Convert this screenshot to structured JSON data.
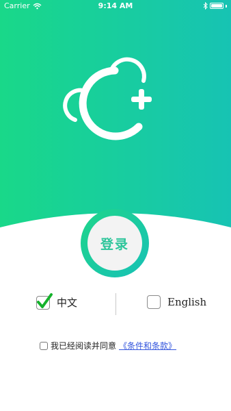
{
  "status_bar": {
    "carrier": "Carrier",
    "time": "9:14 AM",
    "battery_level": 1.0
  },
  "colors": {
    "gradient_start": "#19d889",
    "gradient_end": "#17c3b3",
    "login_text": "#2cc59a",
    "link": "#3355dd"
  },
  "login": {
    "label": "登录"
  },
  "language": {
    "chinese_label": "中文",
    "chinese_checked": true,
    "english_label": "English",
    "english_checked": false
  },
  "agreement": {
    "prefix": "我已经阅读并同意",
    "link_text": "《条件和条款》",
    "checked": false
  },
  "icons": [
    "wifi-icon",
    "signal-icon",
    "battery-icon",
    "bluetooth-icon",
    "logo-icon",
    "checkmark-icon"
  ]
}
